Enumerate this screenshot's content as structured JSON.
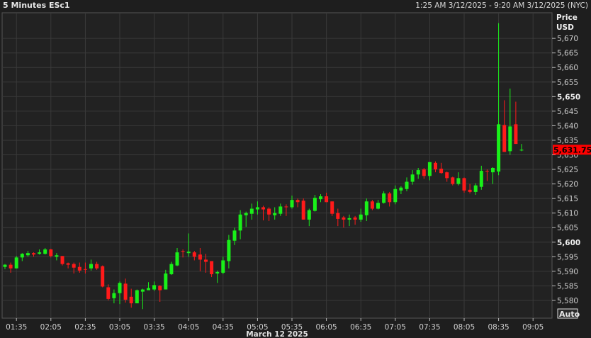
{
  "header": {
    "title": "5 Minutes ESc1",
    "range": "1:25 AM 3/12/2025 - 9:20 AM 3/12/2025 (NYC)"
  },
  "axis": {
    "price_label": "Price",
    "currency_label": "USD",
    "auto_button": "Auto",
    "date_label": "March 12 2025"
  },
  "colors": {
    "up": "#19f019",
    "down": "#ff1a1a",
    "last_price_bg": "#ff0000"
  },
  "chart_data": {
    "type": "candlestick",
    "title": "5 Minutes ESc1",
    "interval_minutes": 5,
    "start_time": "01:25",
    "xlabel": "March 12 2025",
    "ylabel": "Price USD",
    "ylim": [
      5573.9,
      5678.8
    ],
    "grid": true,
    "y_ticks": [
      "5,580",
      "5,585",
      "5,590",
      "5,595",
      "5,600",
      "5,605",
      "5,610",
      "5,615",
      "5,620",
      "5,625",
      "5,630",
      "5,635",
      "5,640",
      "5,645",
      "5,650",
      "5,655",
      "5,660",
      "5,665",
      "5,670"
    ],
    "y_tick_values": [
      5580,
      5585,
      5590,
      5595,
      5600,
      5605,
      5610,
      5615,
      5620,
      5625,
      5630,
      5635,
      5640,
      5645,
      5650,
      5655,
      5660,
      5665,
      5670
    ],
    "bold_ticks": [
      "5,600",
      "5,650"
    ],
    "x_ticks": [
      "01:35",
      "02:05",
      "02:35",
      "03:05",
      "03:35",
      "04:05",
      "04:35",
      "05:05",
      "05:35",
      "06:05",
      "06:35",
      "07:05",
      "07:35",
      "08:05",
      "08:35",
      "09:05"
    ],
    "last_price": 5631.75,
    "last_price_label": "5,631.75",
    "ohlc": [
      [
        5591.5,
        5592.5,
        5590.75,
        5592.25
      ],
      [
        5592.25,
        5593,
        5589.5,
        5591
      ],
      [
        5591,
        5595.25,
        5591,
        5594.75
      ],
      [
        5594.75,
        5596.25,
        5593.5,
        5596
      ],
      [
        5595.5,
        5597,
        5595,
        5596.25
      ],
      [
        5596.25,
        5596.5,
        5595,
        5595.75
      ],
      [
        5596,
        5597.5,
        5595.75,
        5596.5
      ],
      [
        5596,
        5598,
        5595.75,
        5597.5
      ],
      [
        5597.5,
        5597.75,
        5594.75,
        5595.25
      ],
      [
        5595,
        5596.25,
        5593.75,
        5595.5
      ],
      [
        5595.25,
        5595.25,
        5592,
        5592.5
      ],
      [
        5592.75,
        5593,
        5591,
        5592.25
      ],
      [
        5592.5,
        5593,
        5589.25,
        5591.25
      ],
      [
        5591.5,
        5593,
        5589.5,
        5590.25
      ],
      [
        5590.75,
        5593,
        5589.25,
        5590.5
      ],
      [
        5591,
        5594,
        5590.25,
        5592.5
      ],
      [
        5592.5,
        5593.25,
        5590.5,
        5591
      ],
      [
        5591.75,
        5592,
        5584.5,
        5584.75
      ],
      [
        5584.5,
        5585.5,
        5580,
        5580.5
      ],
      [
        5580.75,
        5583.75,
        5579,
        5582.5
      ],
      [
        5582.5,
        5586.5,
        5578.75,
        5586
      ],
      [
        5585.75,
        5587.5,
        5579.25,
        5580.25
      ],
      [
        5581.25,
        5584,
        5577.5,
        5579
      ],
      [
        5579,
        5583.75,
        5579,
        5583.5
      ],
      [
        5583,
        5584,
        5577,
        5583.75
      ],
      [
        5583.5,
        5586.25,
        5583.5,
        5584.25
      ],
      [
        5583.75,
        5586.5,
        5583.25,
        5585.25
      ],
      [
        5585,
        5585.25,
        5579.5,
        5583.5
      ],
      [
        5583.75,
        5590.5,
        5583.75,
        5589.25
      ],
      [
        5589,
        5593.25,
        5588.75,
        5592.5
      ],
      [
        5592,
        5598,
        5591.75,
        5596.5
      ],
      [
        5597,
        5597.5,
        5594.75,
        5596.75
      ],
      [
        5596.25,
        5603,
        5595,
        5596.75
      ],
      [
        5596.5,
        5597,
        5593.75,
        5595
      ],
      [
        5595.75,
        5598,
        5590,
        5594
      ],
      [
        5594,
        5596,
        5589.5,
        5593.25
      ],
      [
        5593.5,
        5593.5,
        5588,
        5589
      ],
      [
        5589.25,
        5590.25,
        5586,
        5589.75
      ],
      [
        5589.5,
        5595,
        5589,
        5593.75
      ],
      [
        5593.5,
        5602.5,
        5591,
        5600.75
      ],
      [
        5600.5,
        5605,
        5599,
        5604
      ],
      [
        5604,
        5611,
        5601,
        5609.5
      ],
      [
        5609.25,
        5610.5,
        5605.25,
        5610
      ],
      [
        5609.75,
        5613.25,
        5607.75,
        5611.5
      ],
      [
        5611.25,
        5614,
        5609.5,
        5612
      ],
      [
        5612,
        5612.5,
        5607.5,
        5611.25
      ],
      [
        5611.5,
        5612,
        5607.25,
        5609.5
      ],
      [
        5609.25,
        5612,
        5607.75,
        5610
      ],
      [
        5609.75,
        5613.25,
        5609,
        5612.25
      ],
      [
        5612.25,
        5613,
        5609,
        5612
      ],
      [
        5612,
        5616,
        5611.5,
        5614.5
      ],
      [
        5614.5,
        5615,
        5612,
        5613.75
      ],
      [
        5614.25,
        5615,
        5607.75,
        5607.75
      ],
      [
        5607.75,
        5611.5,
        5605.5,
        5611
      ],
      [
        5610.75,
        5616.25,
        5610.5,
        5615.25
      ],
      [
        5614.75,
        5616.5,
        5613.75,
        5615.75
      ],
      [
        5615.75,
        5617,
        5613.75,
        5613.75
      ],
      [
        5614,
        5614,
        5609,
        5609.75
      ],
      [
        5610,
        5611.5,
        5605.5,
        5608
      ],
      [
        5608.5,
        5609,
        5605,
        5607.75
      ],
      [
        5607.75,
        5609.5,
        5605.5,
        5608.25
      ],
      [
        5608.5,
        5609,
        5606,
        5607.75
      ],
      [
        5607.75,
        5611.5,
        5607,
        5609.5
      ],
      [
        5609.25,
        5615,
        5607.25,
        5614
      ],
      [
        5614,
        5614.5,
        5611,
        5611.5
      ],
      [
        5611.5,
        5614.5,
        5611.25,
        5613.5
      ],
      [
        5613.5,
        5617.5,
        5613.25,
        5616.75
      ],
      [
        5616.75,
        5617.25,
        5612.25,
        5613.75
      ],
      [
        5613.75,
        5619.5,
        5613,
        5618.25
      ],
      [
        5617.75,
        5619.25,
        5616.5,
        5618.75
      ],
      [
        5618.25,
        5622.25,
        5617.5,
        5620.75
      ],
      [
        5620.75,
        5624.75,
        5619.75,
        5623.25
      ],
      [
        5623.25,
        5625.5,
        5621.75,
        5624.75
      ],
      [
        5625,
        5625.5,
        5621.75,
        5622.75
      ],
      [
        5622.75,
        5627.5,
        5621.25,
        5627.5
      ],
      [
        5627.25,
        5627.75,
        5624,
        5625
      ],
      [
        5625.25,
        5627.25,
        5623.5,
        5623.75
      ],
      [
        5624,
        5624.25,
        5620.75,
        5622
      ],
      [
        5622.25,
        5622.5,
        5619.5,
        5620
      ],
      [
        5620,
        5624,
        5619.5,
        5622
      ],
      [
        5622,
        5622.25,
        5617,
        5617.75
      ],
      [
        5618,
        5620,
        5616.75,
        5617.25
      ],
      [
        5617.25,
        5620.25,
        5616.25,
        5619.5
      ],
      [
        5619,
        5626.25,
        5618,
        5624.5
      ],
      [
        5624.5,
        5625,
        5621,
        5624.25
      ],
      [
        5624,
        5625.75,
        5620,
        5625.5
      ],
      [
        5624.25,
        5675.25,
        5623,
        5640.5
      ],
      [
        5640.25,
        5648.75,
        5631,
        5631
      ],
      [
        5631.25,
        5652.75,
        5630,
        5639.75
      ],
      [
        5640.5,
        5648.25,
        5633.75,
        5633.75
      ],
      [
        5631.5,
        5633.75,
        5631.25,
        5631.75
      ]
    ]
  }
}
